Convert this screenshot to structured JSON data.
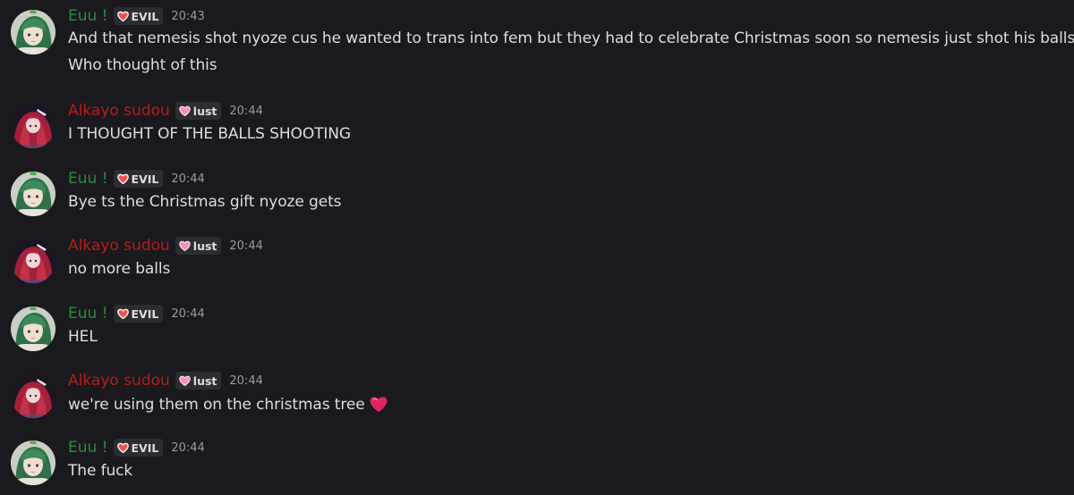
{
  "colors": {
    "background": "#1a1a1e",
    "text": "#dbdee1",
    "timestamp": "#949ba4",
    "tag_bg": "#2b2d31",
    "euu_name": "#2d8a3e",
    "alkayo_name": "#b41d1d",
    "heart": "#e0245e",
    "tag_heart": "#f58fc0"
  },
  "messages": [
    {
      "author": "Euu !",
      "tag": "EVIL",
      "time": "20:43",
      "lines": [
        "And that nemesis shot nyoze cus he wanted to trans into fem but they had to celebrate Christmas soon so nemesis just shot his balls",
        "Who thought of this"
      ]
    },
    {
      "author": "Alkayo sudou",
      "tag": "lust",
      "time": "20:44",
      "lines": [
        "I THOUGHT OF THE BALLS SHOOTING"
      ]
    },
    {
      "author": "Euu !",
      "tag": "EVIL",
      "time": "20:44",
      "lines": [
        "Bye ts the Christmas gift nyoze gets"
      ]
    },
    {
      "author": "Alkayo sudou",
      "tag": "lust",
      "time": "20:44",
      "lines": [
        "no more balls"
      ]
    },
    {
      "author": "Euu !",
      "tag": "EVIL",
      "time": "20:44",
      "lines": [
        "HEL"
      ]
    },
    {
      "author": "Alkayo sudou",
      "tag": "lust",
      "time": "20:44",
      "lines": [
        "we're using them on the christmas tree"
      ],
      "emoji": "red-heart-icon"
    },
    {
      "author": "Euu !",
      "tag": "EVIL",
      "time": "20:44",
      "lines": [
        "The fuck"
      ]
    }
  ]
}
